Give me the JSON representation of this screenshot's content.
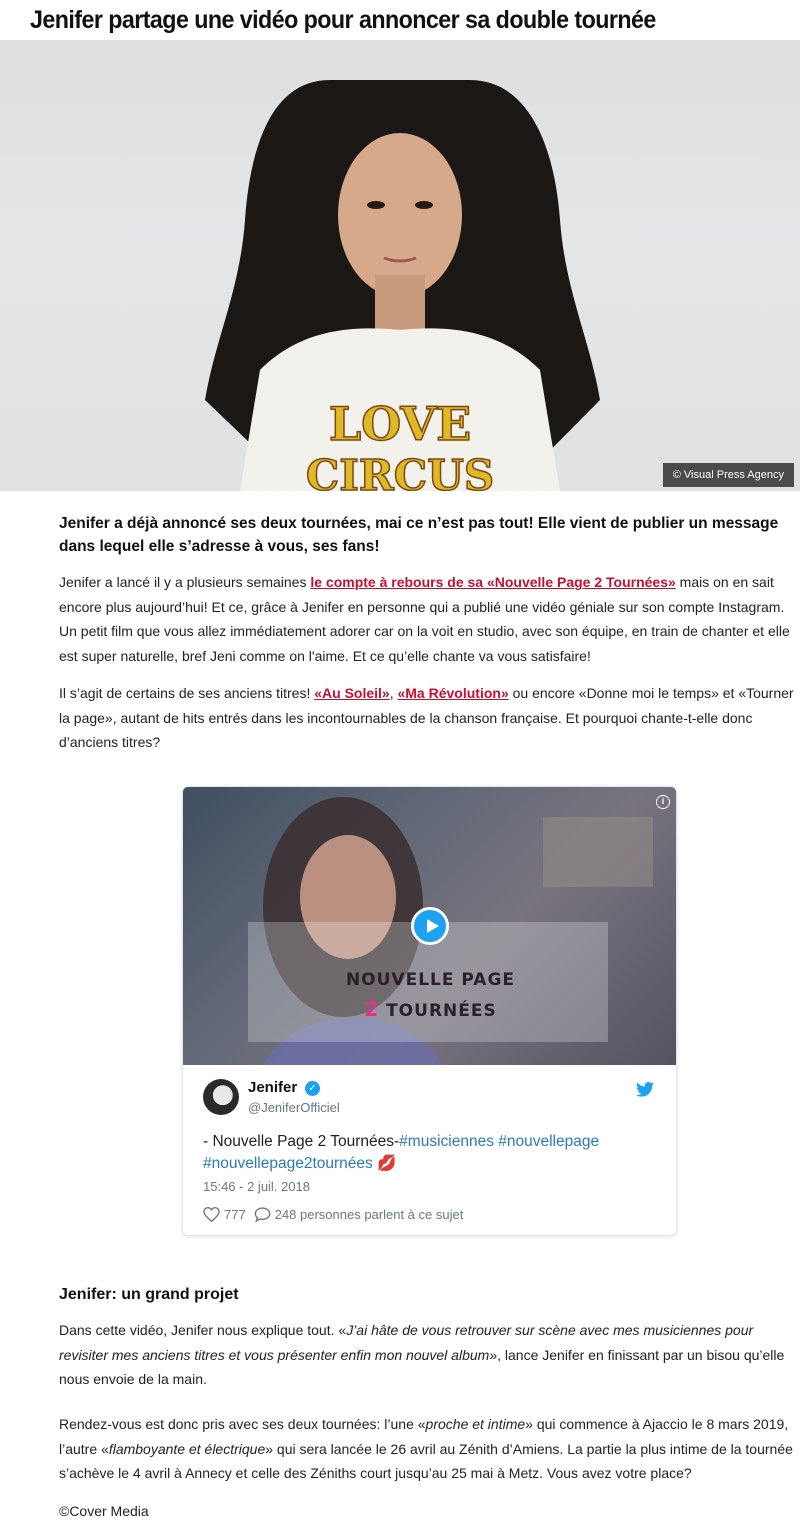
{
  "article": {
    "headline": "Jenifer partage une vidéo pour annoncer sa double tournée",
    "image_credit": "© Visual Press Agency",
    "image_shirt_text_line1": "LOVE",
    "image_shirt_text_line2": "CIRCUS",
    "lead": "Jenifer a déjà annoncé ses deux tournées, mai ce n’est pas tout! Elle vient de publier un message dans lequel elle s’adresse à vous, ses fans!",
    "p1_before": "Jenifer a lancé il y a plusieurs semaines ",
    "p1_link": "le compte à rebours de sa «Nouvelle Page 2 Tournées»",
    "p1_after": " mais on en sait encore plus aujourd’hui! Et ce, grâce à Jenifer en personne qui a publié une vidéo géniale sur son compte Instagram. Un petit film que vous allez immédiatement adorer car on la voit en studio, avec son équipe, en train de chanter et elle est super naturelle, bref Jeni comme on l'aime. Et ce qu’elle chante va vous satisfaire!",
    "p2_before": "Il s’agit de certains de ses anciens titres! ",
    "p2_link1": "«Au Soleil»",
    "p2_sep": ", ",
    "p2_link2": "«Ma Révolution»",
    "p2_after": " ou encore «Donne moi le temps» et «Tourner la page», autant de hits entrés dans les incontournables de la chanson française. Et pourquoi chante-t-elle donc d’anciens titres?",
    "section_heading": "Jenifer: un grand projet",
    "p3_before": "Dans cette vidéo, Jenifer nous explique tout. «",
    "p3_quote": "J’ai hâte de vous retrouver sur scène avec mes musiciennes pour revisiter mes anciens titres et vous présenter enfin mon nouvel album",
    "p3_after": "», lance Jenifer en finissant par un bisou qu’elle nous envoie de la main.",
    "p4_a": "Rendez-vous est donc pris avec ses deux tournées: l’une «",
    "p4_q1": "proche et intime",
    "p4_b": "» qui commence à Ajaccio le 8 mars 2019, l’autre «",
    "p4_q2": "flamboyante et électrique",
    "p4_c": "» qui sera lancée le 26 avril au Zénith d’Amiens. La partie la plus intime de la tournée s’achève le 4 avril à Annecy et celle des Zéniths court jusqu’au 25 mai à Metz. Vous avez votre place?",
    "footer": "©Cover Media"
  },
  "tweet": {
    "video_title_line1": "NOUVELLE PAGE",
    "video_title_num": "2",
    "video_title_line2": " TOURNÉES",
    "info_icon": "i",
    "author_name": "Jenifer",
    "verified_glyph": "✓",
    "handle": "@JeniferOfficiel",
    "text_plain": "- Nouvelle Page 2 Tournées-",
    "hashtag1": "#musiciennes",
    "hashtag2": "#nouvellepage",
    "hashtag3": "#nouvellepage2tournées",
    "emoji": "💋",
    "date": "15:46 - 2 juil. 2018",
    "likes": "777",
    "replies": "248 personnes parlent à ce sujet"
  },
  "colors": {
    "link_red": "#c8102e",
    "twitter_blue": "#1da1f2",
    "hashtag_blue": "#2b7bb9",
    "accent_pink": "#e2318a"
  },
  "icons": [
    "info-icon",
    "play-icon",
    "verified-icon",
    "twitter-bird-icon",
    "heart-icon",
    "reply-bubble-icon"
  ]
}
